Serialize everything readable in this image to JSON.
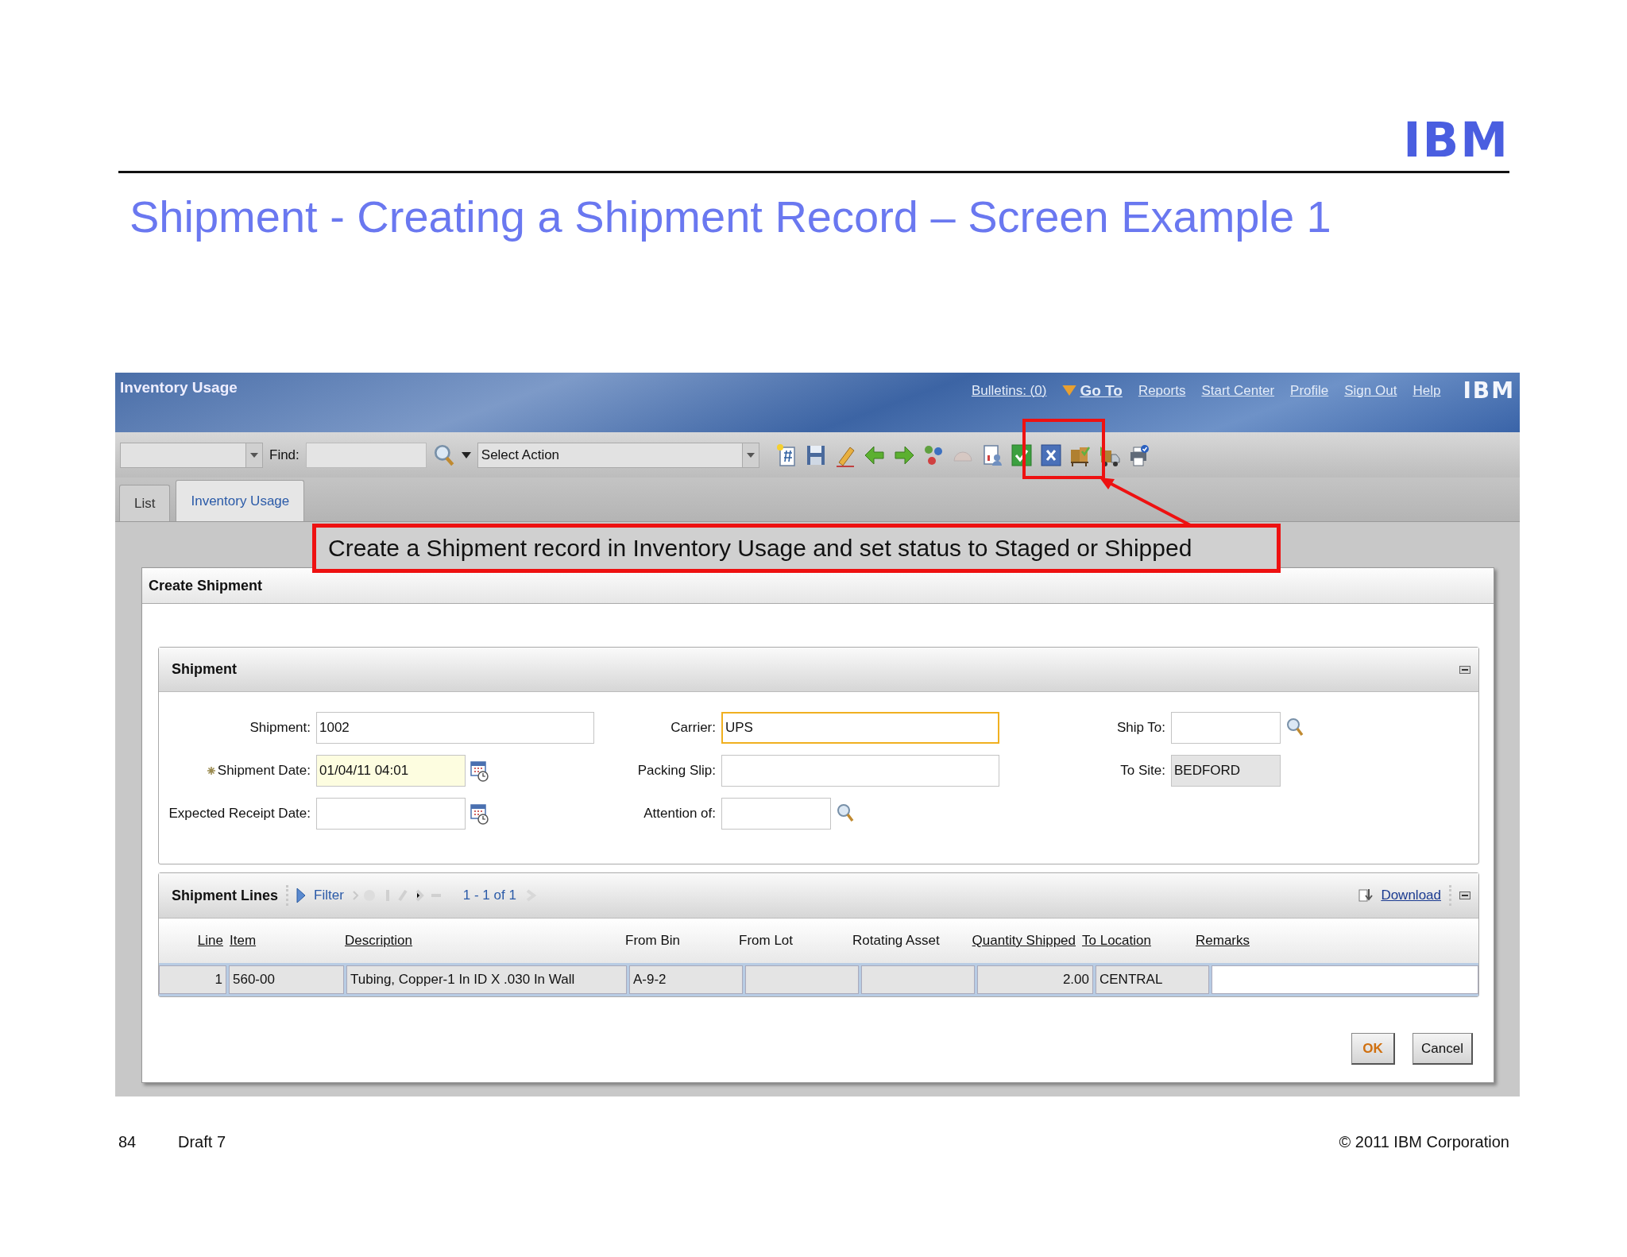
{
  "slide": {
    "logo": "IBM",
    "title": "Shipment - Creating a Shipment Record – Screen Example 1",
    "footer": {
      "page": "84",
      "draft": "Draft 7",
      "copyright": "© 2011 IBM Corporation"
    }
  },
  "app": {
    "title": "Inventory Usage",
    "nav": [
      {
        "label": "Bulletins: (0)",
        "kind": "link"
      },
      {
        "label": "Go To",
        "kind": "menu"
      },
      {
        "label": "Reports",
        "kind": "link"
      },
      {
        "label": "Start Center",
        "kind": "link"
      },
      {
        "label": "Profile",
        "kind": "link"
      },
      {
        "label": "Sign Out",
        "kind": "link"
      },
      {
        "label": "Help",
        "kind": "link"
      }
    ],
    "logo": "IBM",
    "toolbar": {
      "find_label": "Find:",
      "action_placeholder": "Select Action"
    },
    "tabs": [
      {
        "label": "List",
        "selected": false
      },
      {
        "label": "Inventory Usage",
        "selected": true
      }
    ],
    "callout": "Create a Shipment record in Inventory Usage and set status to Staged or Shipped",
    "dialog": {
      "title": "Create Shipment",
      "section": {
        "title": "Shipment",
        "columns": [
          [
            {
              "label": "Shipment:",
              "value": "1002",
              "required": false,
              "focused": false,
              "readonly": false
            },
            {
              "label": "Shipment Date:",
              "value": "01/04/11 04:01",
              "required": true,
              "focused": false,
              "readonly": false,
              "kind": "date"
            },
            {
              "label": "Expected Receipt Date:",
              "required": false,
              "focused": false,
              "readonly": false,
              "kind": "date"
            }
          ],
          [
            {
              "label": "Carrier:",
              "value": "UPS",
              "required": false,
              "focused": true,
              "readonly": false
            },
            {
              "label": "Packing Slip:",
              "required": false,
              "focused": false,
              "readonly": false
            },
            {
              "label": "Attention of:",
              "required": false,
              "focused": false,
              "readonly": false,
              "kind": "lookup"
            }
          ],
          [
            {
              "label": "Ship To:",
              "required": false,
              "focused": false,
              "readonly": false,
              "kind": "lookup"
            },
            {
              "label": "To Site:",
              "value": "BEDFORD",
              "required": false,
              "focused": false,
              "readonly": true
            }
          ]
        ]
      },
      "lines": {
        "title": "Shipment Lines",
        "filter": "Filter",
        "count": "1 - 1 of 1",
        "download": "Download",
        "columns": [
          {
            "label": "Line",
            "sortable": true,
            "kind": "number"
          },
          {
            "label": "Item",
            "sortable": true,
            "kind": "text"
          },
          {
            "label": "Description",
            "sortable": true,
            "kind": "text"
          },
          {
            "label": "From Bin",
            "sortable": false,
            "kind": "text"
          },
          {
            "label": "From Lot",
            "sortable": false,
            "kind": "text"
          },
          {
            "label": "Rotating Asset",
            "sortable": false,
            "kind": "text"
          },
          {
            "label": "Quantity Shipped",
            "sortable": true,
            "kind": "number"
          },
          {
            "label": "To Location",
            "sortable": true,
            "kind": "text"
          },
          {
            "label": "Remarks",
            "sortable": true,
            "kind": "editable"
          }
        ],
        "rows": [
          [
            "1",
            "560-00",
            "Tubing, Copper-1 In ID X .030 In Wall",
            "A-9-2",
            "",
            "",
            "2.00",
            "CENTRAL",
            ""
          ]
        ]
      },
      "buttons": [
        {
          "label": "OK",
          "kind": "primary"
        },
        {
          "label": "Cancel",
          "kind": "secondary"
        }
      ]
    }
  }
}
